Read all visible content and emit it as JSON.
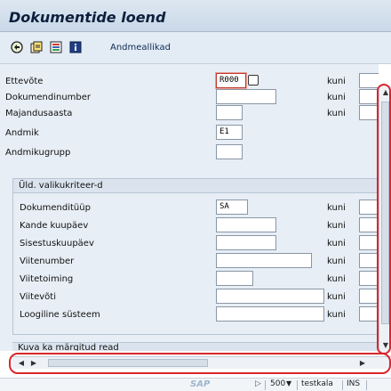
{
  "window": {
    "title": "Dokumentide loend"
  },
  "toolbar": {
    "text_button": "Andmeallikad"
  },
  "fields": {
    "ettevote": {
      "label": "Ettevõte",
      "value": "R000",
      "to_label": "kuni"
    },
    "dokumendinumber": {
      "label": "Dokumendinumber",
      "value": "",
      "to_label": "kuni"
    },
    "majandusaasta": {
      "label": "Majandusaasta",
      "value": "",
      "to_label": "kuni"
    },
    "andmik": {
      "label": "Andmik",
      "value": "E1"
    },
    "andmikugrupp": {
      "label": "Andmikugrupp",
      "value": ""
    }
  },
  "group": {
    "title": "Üld. valikukriteer-d",
    "rows": [
      {
        "label": "Dokumenditüüp",
        "value": "SA",
        "to_label": "kuni"
      },
      {
        "label": "Kande kuupäev",
        "value": "",
        "to_label": "kuni"
      },
      {
        "label": "Sisestuskuupäev",
        "value": "",
        "to_label": "kuni"
      },
      {
        "label": "Viitenumber",
        "value": "",
        "to_label": "kuni"
      },
      {
        "label": "Viitetoiming",
        "value": "",
        "to_label": "kuni"
      },
      {
        "label": "Viitevõti",
        "value": "",
        "to_label": "kuni"
      },
      {
        "label": "Loogiline süsteem",
        "value": "",
        "to_label": "kuni"
      }
    ]
  },
  "bottom_group": {
    "title": "Kuva ka märgitud read"
  },
  "status_bar": {
    "logo": "SAP",
    "session": "500",
    "server": "testkala",
    "mode": "INS"
  },
  "colors": {
    "highlight": "#d9262c",
    "title_text": "#0d1f3c"
  },
  "icons": [
    "execute-icon",
    "get-variant-icon",
    "selection-options-icon",
    "info-icon"
  ]
}
